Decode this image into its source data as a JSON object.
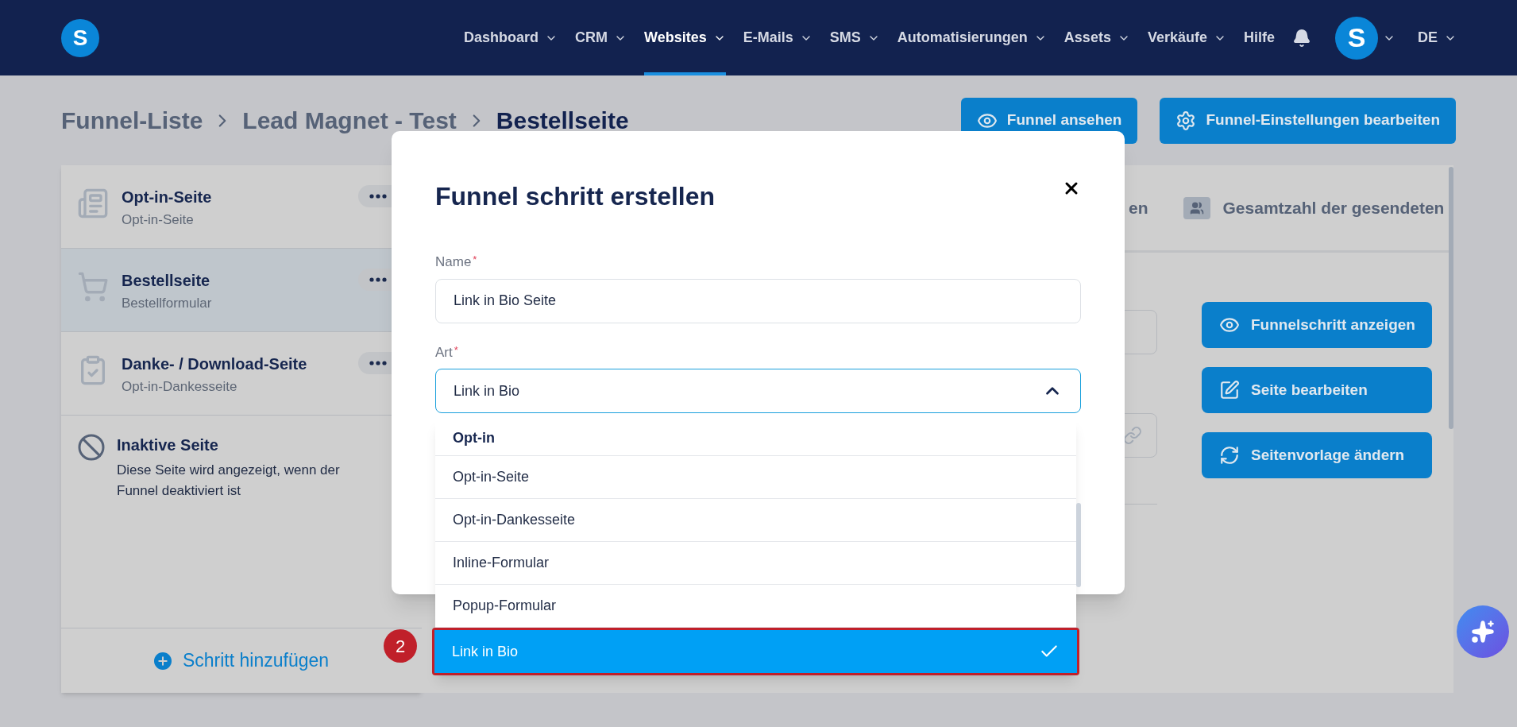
{
  "logo": "S",
  "nav": {
    "items": [
      {
        "label": "Dashboard",
        "dropdown": true,
        "selected": false
      },
      {
        "label": "CRM",
        "dropdown": true,
        "selected": false
      },
      {
        "label": "Websites",
        "dropdown": true,
        "selected": true
      },
      {
        "label": "E-Mails",
        "dropdown": true,
        "selected": false
      },
      {
        "label": "SMS",
        "dropdown": true,
        "selected": false
      },
      {
        "label": "Automatisierungen",
        "dropdown": true,
        "selected": false
      },
      {
        "label": "Assets",
        "dropdown": true,
        "selected": false
      },
      {
        "label": "Verkäufe",
        "dropdown": true,
        "selected": false
      },
      {
        "label": "Hilfe",
        "dropdown": false,
        "selected": false
      }
    ],
    "avatar": "S",
    "language": "DE"
  },
  "breadcrumb": [
    "Funnel-Liste",
    "Lead Magnet - Test",
    "Bestellseite"
  ],
  "header_buttons": [
    "Funnel ansehen",
    "Funnel-Einstellungen bearbeiten"
  ],
  "steps": [
    {
      "title": "Opt-in-Seite",
      "subtitle": "Opt-in-Seite",
      "selected": false
    },
    {
      "title": "Bestellseite",
      "subtitle": "Bestellformular",
      "selected": true
    },
    {
      "title": "Danke- / Download-Seite",
      "subtitle": "Opt-in-Dankesseite",
      "selected": false
    }
  ],
  "inactive_page": {
    "title": "Inaktive Seite",
    "description": "Diese Seite wird angezeigt, wenn der Funnel deaktiviert ist"
  },
  "add_step": "Schritt hinzufügen",
  "step_badge": "2",
  "stats_tabs": [
    "en",
    "Gesamtzahl der gesendeten"
  ],
  "actions": [
    "Funnelschritt anzeigen",
    "Seite bearbeiten",
    "Seitenvorlage ändern"
  ],
  "modal": {
    "title": "Funnel schritt erstellen",
    "name_field": {
      "label": "Name",
      "required_mark": "*",
      "value": "Link in Bio Seite"
    },
    "type_field": {
      "label": "Art",
      "required_mark": "*",
      "value": "Link in Bio",
      "expanded": true
    },
    "dropdown": {
      "group": "Opt-in",
      "options": [
        {
          "label": "Opt-in-Seite",
          "selected": false
        },
        {
          "label": "Opt-in-Dankesseite",
          "selected": false
        },
        {
          "label": "Inline-Formular",
          "selected": false
        },
        {
          "label": "Popup-Formular",
          "selected": false
        },
        {
          "label": "Link in Bio",
          "selected": true
        }
      ]
    }
  }
}
